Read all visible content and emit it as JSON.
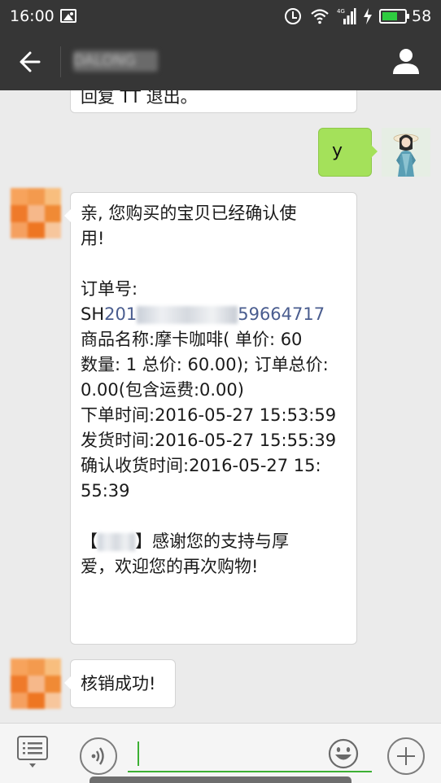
{
  "status_bar": {
    "time": "16:00",
    "battery": "58",
    "network_type": "4G"
  },
  "header": {
    "contact_name": "DALONG"
  },
  "messages": {
    "previous_tail": "回复 TT 退出。",
    "sent_text": "y",
    "order": {
      "greeting_1": "亲, 您购买的宝贝已经确认使",
      "greeting_2": "用!",
      "order_label": "订单号:",
      "order_prefix": "SH",
      "order_link_start": "201",
      "order_link_end": "59664717",
      "product_line": "商品名称:摩卡咖啡(  单价: 60",
      "quantity_line": "数量: 1 总价: 60.00);  订单总价:",
      "total_line": "0.00(包含运费:0.00)",
      "ordered_time": "下单时间:2016-05-27 15:53:59",
      "shipped_time": "发货时间:2016-05-27 15:55:39",
      "received_time_1": "确认收货时间:2016-05-27 15:",
      "received_time_2": "55:39",
      "thanks_open": "【",
      "thanks_close": "】感谢您的支持与厚",
      "thanks_line_2": "爱，欢迎您的再次购物!"
    },
    "confirmation": "核销成功!"
  },
  "colors": {
    "top_bar": "#363636",
    "chat_background": "#ebebeb",
    "sent_bubble": "#a4e15a",
    "link": "#4a5d8f",
    "input_accent": "#3cb034"
  }
}
